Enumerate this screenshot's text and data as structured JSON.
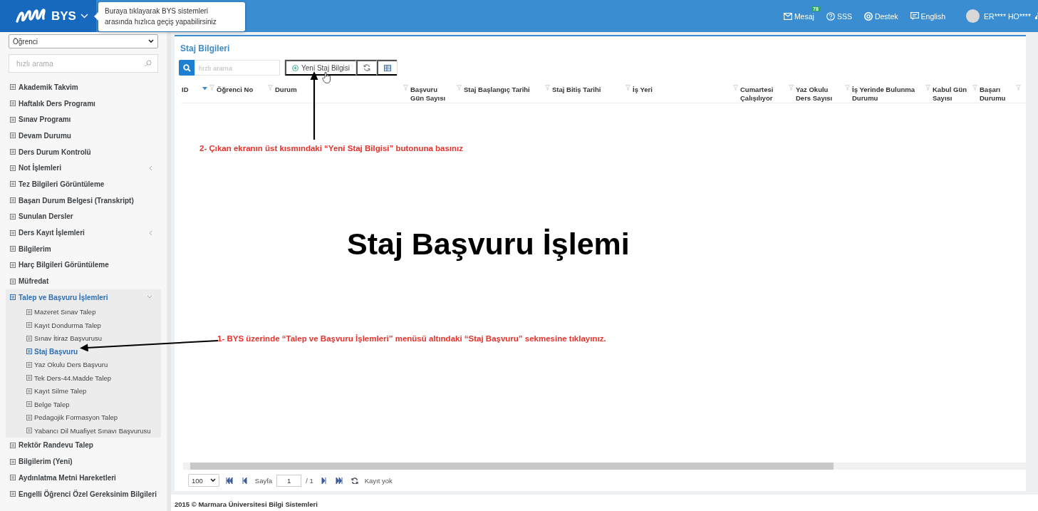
{
  "header": {
    "app_name": "BYS",
    "tooltip": "Buraya tıklayarak BYS sistemleri arasında hızlıca geçiş yapabilirsiniz",
    "links": [
      {
        "kind": "mail",
        "label": "Mesaj",
        "badge": "78"
      },
      {
        "kind": "help",
        "label": "SSS"
      },
      {
        "kind": "support",
        "label": "Destek"
      },
      {
        "kind": "language",
        "label": "English"
      }
    ],
    "user": "ER**** HO****"
  },
  "sidebar": {
    "role": "Öğrenci",
    "search_placeholder": "hızlı arama",
    "items": [
      {
        "label": "Akademik Takvim",
        "selected": false
      },
      {
        "label": "Haftalık Ders Programı",
        "selected": false
      },
      {
        "label": "Sınav Programı",
        "selected": false
      },
      {
        "label": "Devam Durumu",
        "selected": false
      },
      {
        "label": "Ders Durum Kontrolü",
        "selected": false
      },
      {
        "label": "Not İşlemleri",
        "selected": false,
        "expanded": false
      },
      {
        "label": "Tez Bilgileri Görüntüleme",
        "selected": false
      },
      {
        "label": "Başarı Durum Belgesi (Transkript)",
        "selected": false
      },
      {
        "label": "Sunulan Dersler",
        "selected": false
      },
      {
        "label": "Ders Kayıt İşlemleri",
        "selected": false,
        "expanded": false
      },
      {
        "label": "Bilgilerim",
        "selected": false
      },
      {
        "label": "Harç Bilgileri Görüntüleme",
        "selected": false
      },
      {
        "label": "Müfredat",
        "selected": false
      },
      {
        "label": "Talep ve Başvuru İşlemleri",
        "selected": false,
        "expanded": true,
        "children": [
          {
            "label": "Mazeret Sınav Talep",
            "selected": false
          },
          {
            "label": "Kayıt Dondurma Talep",
            "selected": false
          },
          {
            "label": "Sınav İtiraz Başvurusu",
            "selected": false
          },
          {
            "label": "Staj Başvuru",
            "selected": true
          },
          {
            "label": "Yaz Okulu Ders Başvuru",
            "selected": false
          },
          {
            "label": "Tek Ders-44.Madde Talep",
            "selected": false
          },
          {
            "label": "Kayıt Silme Talep",
            "selected": false
          },
          {
            "label": "Belge Talep",
            "selected": false
          },
          {
            "label": "Pedagojik Formasyon Talep",
            "selected": false
          },
          {
            "label": "Yabancı Dil Muafiyet Sınavı Başvurusu",
            "selected": false
          }
        ]
      },
      {
        "label": "Rektör Randevu Talep",
        "selected": false
      },
      {
        "label": "Bilgilerim (Yeni)",
        "selected": false
      },
      {
        "label": "Aydınlatma Metni Hareketleri",
        "selected": false
      },
      {
        "label": "Engelli Öğrenci Özel Gereksinim Bilgileri",
        "selected": false
      }
    ]
  },
  "main": {
    "title": "Staj Bilgileri",
    "search_placeholder": "hızlı arama",
    "new_button": "Yeni Staj Bilgisi",
    "columns": [
      {
        "label": "ID",
        "sorted": true
      },
      {
        "label": "Öğrenci No",
        "sorted": false
      },
      {
        "label": "Durum",
        "sorted": false
      },
      {
        "label": "Başvuru Gün Sayısı",
        "sorted": false
      },
      {
        "label": "Staj Başlangıç Tarihi",
        "sorted": false
      },
      {
        "label": "Staj Bitiş Tarihi",
        "sorted": false
      },
      {
        "label": "İş Yeri",
        "sorted": false
      },
      {
        "label": "Cumartesi Çalışılıyor",
        "sorted": false
      },
      {
        "label": "Yaz Okulu Ders Sayısı",
        "sorted": false
      },
      {
        "label": "İş Yerinde Bulunma Durumu",
        "sorted": false
      },
      {
        "label": "Kabul Gün Sayısı",
        "sorted": false
      },
      {
        "label": "Başarı Durumu",
        "sorted": false
      }
    ],
    "pager": {
      "page_size": "100",
      "page_label": "Sayfa",
      "page": "1",
      "page_total": "/ 1",
      "status": "Kayıt yok"
    }
  },
  "footer": "2015 © Marmara Üniversitesi Bilgi Sistemleri",
  "annotations": {
    "heading": "Staj Başvuru İşlemi",
    "steps": [
      "2- Çıkan ekranın üst kısmındaki “Yeni Staj Bilgisi” butonuna basınız",
      "1- BYS üzerinde “Talep ve Başvuru İşlemleri” menüsü altındaki “Staj Başvuru” sekmesine tıklayınız."
    ]
  }
}
